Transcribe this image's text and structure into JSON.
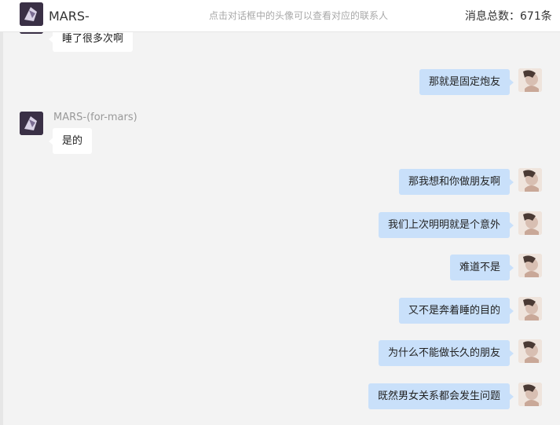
{
  "header": {
    "title": "MARS-",
    "hint": "点击对话框中的头像可以查看对应的联系人",
    "count_label": "消息总数：671条"
  },
  "messages": [
    {
      "side": "left",
      "text": "睡了很多次啊"
    },
    {
      "side": "right",
      "text": "那就是固定炮友"
    },
    {
      "side": "left",
      "sender": "MARS-(for-mars)",
      "text": "是的"
    },
    {
      "side": "right",
      "text": "那我想和你做朋友啊"
    },
    {
      "side": "right",
      "text": "我们上次明明就是个意外"
    },
    {
      "side": "right",
      "text": "难道不是"
    },
    {
      "side": "right",
      "text": "又不是奔着睡的目的"
    },
    {
      "side": "right",
      "text": "为什么不能做长久的朋友"
    },
    {
      "side": "right",
      "text": "既然男女关系都会发生问题"
    }
  ],
  "colors": {
    "right_bubble": "#c9e0fa",
    "left_bubble": "#ffffff",
    "background": "#f3f3f3"
  },
  "icons": {
    "contact_avatar": "mars-avatar-icon",
    "self_avatar": "user-avatar-icon"
  }
}
